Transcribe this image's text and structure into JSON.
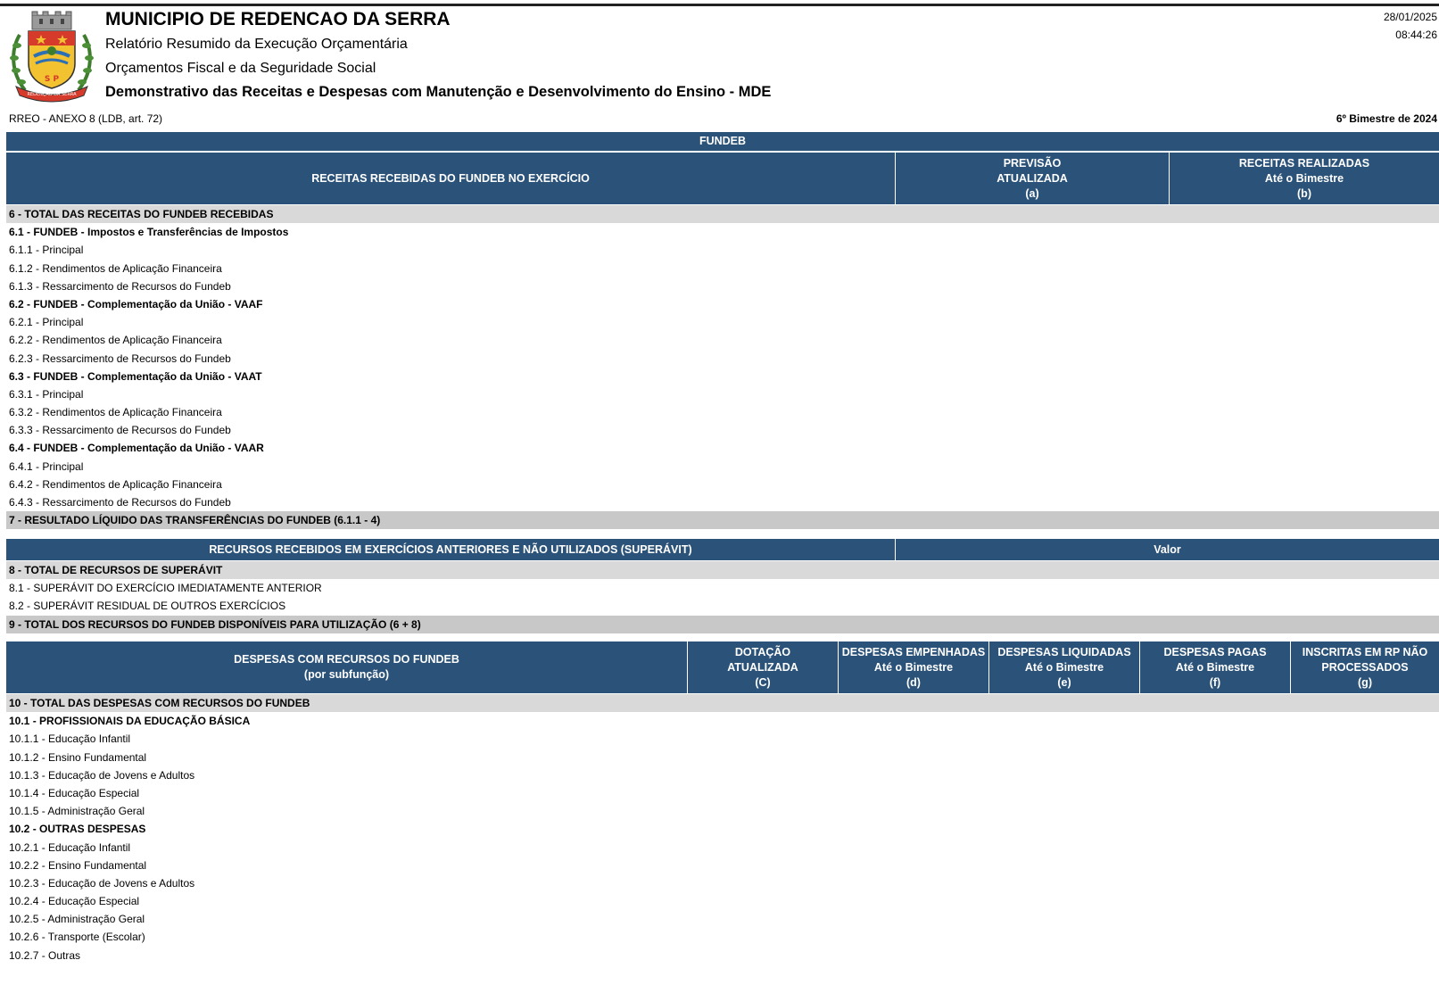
{
  "header": {
    "municipality": "MUNICIPIO DE REDENCAO DA SERRA",
    "report": "Relatório Resumido da Execução Orçamentária",
    "budgets": "Orçamentos Fiscal e da Seguridade Social",
    "statement": "Demonstrativo das Receitas e Despesas com Manutenção e Desenvolvimento do Ensino - MDE",
    "date": "28/01/2025",
    "time": "08:44:26",
    "crest_text": "REDENÇÃO DA SERRA",
    "crest_letters": "S P"
  },
  "annex": {
    "label": "RREO - ANEXO 8 (LDB, art. 72)",
    "period": "6º Bimestre de 2024"
  },
  "fundeb_title": "FUNDEB",
  "revenues": {
    "col_desc": "RECEITAS RECEBIDAS DO FUNDEB NO EXERCÍCIO",
    "col_a": [
      "PREVISÃO",
      "ATUALIZADA",
      "(a)"
    ],
    "col_b": [
      "RECEITAS REALIZADAS",
      "Até o Bimestre",
      "(b)"
    ],
    "rows": [
      {
        "label": "6 - TOTAL DAS RECEITAS DO FUNDEB RECEBIDAS",
        "style": "total"
      },
      {
        "label": "6.1 - FUNDEB - Impostos e Transferências de Impostos",
        "style": "bold"
      },
      {
        "label": "6.1.1 - Principal",
        "style": ""
      },
      {
        "label": "6.1.2 - Rendimentos de Aplicação Financeira",
        "style": ""
      },
      {
        "label": "6.1.3 - Ressarcimento de Recursos do Fundeb",
        "style": ""
      },
      {
        "label": "6.2 - FUNDEB - Complementação da União - VAAF",
        "style": "bold"
      },
      {
        "label": "6.2.1 - Principal",
        "style": ""
      },
      {
        "label": "6.2.2 - Rendimentos de Aplicação Financeira",
        "style": ""
      },
      {
        "label": "6.2.3 - Ressarcimento de Recursos do Fundeb",
        "style": ""
      },
      {
        "label": "6.3 - FUNDEB - Complementação da União - VAAT",
        "style": "bold"
      },
      {
        "label": "6.3.1 - Principal",
        "style": ""
      },
      {
        "label": "6.3.2 - Rendimentos de Aplicação Financeira",
        "style": ""
      },
      {
        "label": "6.3.3 - Ressarcimento de Recursos do Fundeb",
        "style": ""
      },
      {
        "label": "6.4 - FUNDEB - Complementação da União - VAAR",
        "style": "bold"
      },
      {
        "label": "6.4.1 - Principal",
        "style": ""
      },
      {
        "label": "6.4.2 - Rendimentos de Aplicação Financeira",
        "style": ""
      },
      {
        "label": "6.4.3 - Ressarcimento de Recursos do Fundeb",
        "style": ""
      },
      {
        "label": "7 - RESULTADO LÍQUIDO DAS TRANSFERÊNCIAS DO FUNDEB (6.1.1 - 4)",
        "style": "total2"
      }
    ]
  },
  "surplus": {
    "col_desc": "RECURSOS RECEBIDOS EM EXERCÍCIOS ANTERIORES E NÃO UTILIZADOS (SUPERÁVIT)",
    "col_value": "Valor",
    "rows": [
      {
        "label": "8 - TOTAL DE RECURSOS DE SUPERÁVIT",
        "style": "total"
      },
      {
        "label": "8.1 - SUPERÁVIT DO EXERCÍCIO IMEDIATAMENTE ANTERIOR",
        "style": ""
      },
      {
        "label": "8.2 - SUPERÁVIT RESIDUAL DE OUTROS EXERCÍCIOS",
        "style": ""
      },
      {
        "label": "9 - TOTAL DOS RECURSOS DO FUNDEB DISPONÍVEIS PARA UTILIZAÇÃO (6 + 8)",
        "style": "total2"
      }
    ]
  },
  "expenses": {
    "col_desc": [
      "DESPESAS COM RECURSOS DO FUNDEB",
      "(por subfunção)"
    ],
    "col_c": [
      "DOTAÇÃO",
      "ATUALIZADA",
      "(C)"
    ],
    "col_d": [
      "DESPESAS EMPENHADAS",
      "Até o Bimestre",
      "(d)"
    ],
    "col_e": [
      "DESPESAS LIQUIDADAS",
      "Até o Bimestre",
      "(e)"
    ],
    "col_f": [
      "DESPESAS PAGAS",
      "Até o Bimestre",
      "(f)"
    ],
    "col_g": [
      "INSCRITAS EM RP NÃO",
      "PROCESSADOS",
      "(g)"
    ],
    "rows": [
      {
        "label": "10 - TOTAL DAS DESPESAS COM RECURSOS DO FUNDEB",
        "style": "total"
      },
      {
        "label": "10.1 - PROFISSIONAIS DA EDUCAÇÃO BÁSICA",
        "style": "bold"
      },
      {
        "label": "10.1.1 - Educação Infantil",
        "style": ""
      },
      {
        "label": "10.1.2 - Ensino Fundamental",
        "style": ""
      },
      {
        "label": "10.1.3 - Educação de Jovens e Adultos",
        "style": ""
      },
      {
        "label": "10.1.4 - Educação Especial",
        "style": ""
      },
      {
        "label": "10.1.5 - Administração Geral",
        "style": ""
      },
      {
        "label": "10.2 - OUTRAS DESPESAS",
        "style": "bold"
      },
      {
        "label": "10.2.1 - Educação Infantil",
        "style": ""
      },
      {
        "label": "10.2.2 - Ensino Fundamental",
        "style": ""
      },
      {
        "label": "10.2.3 - Educação de Jovens e Adultos",
        "style": ""
      },
      {
        "label": "10.2.4 - Educação Especial",
        "style": ""
      },
      {
        "label": "10.2.5 - Administração Geral",
        "style": ""
      },
      {
        "label": "10.2.6 - Transporte (Escolar)",
        "style": ""
      },
      {
        "label": "10.2.7 - Outras",
        "style": ""
      }
    ]
  }
}
